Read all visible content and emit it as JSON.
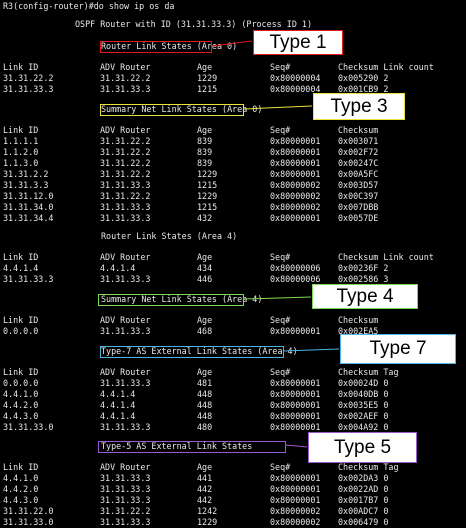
{
  "terminal": {
    "prompt_line": "R3(config-router)#do show ip os da",
    "router_banner": "OSPF Router with ID (31.31.33.3) (Process ID 1)"
  },
  "sections": [
    {
      "title": "Router Link States",
      "area": "(Area 0)",
      "callout": "Type 1",
      "columns": [
        "Link ID",
        "ADV Router",
        "Age",
        "Seq#",
        "Checksum Link count"
      ],
      "rows": [
        [
          "31.31.22.2",
          "31.31.22.2",
          "1229",
          "0x80000004",
          "0x005290 2"
        ],
        [
          "31.31.33.3",
          "31.31.33.3",
          "1215",
          "0x80000004",
          "0x001CB9 2"
        ]
      ]
    },
    {
      "title": "Summary Net Link States",
      "area": "(Area 0)",
      "callout": "Type 3",
      "columns": [
        "Link ID",
        "ADV Router",
        "Age",
        "Seq#",
        "Checksum"
      ],
      "rows": [
        [
          "1.1.1.1",
          "31.31.22.2",
          "839",
          "0x80000001",
          "0x003071"
        ],
        [
          "1.1.2.0",
          "31.31.22.2",
          "839",
          "0x80000001",
          "0x002F72"
        ],
        [
          "1.1.3.0",
          "31.31.22.2",
          "839",
          "0x80000001",
          "0x00247C"
        ],
        [
          "31.31.2.2",
          "31.31.22.2",
          "1229",
          "0x80000001",
          "0x00A5FC"
        ],
        [
          "31.31.3.3",
          "31.31.33.3",
          "1215",
          "0x80000002",
          "0x003D57"
        ],
        [
          "31.31.12.0",
          "31.31.22.2",
          "1229",
          "0x80000002",
          "0x00C397"
        ],
        [
          "31.31.34.0",
          "31.31.33.3",
          "1215",
          "0x80000002",
          "0x007DBB"
        ],
        [
          "31.31.34.4",
          "31.31.33.3",
          "432",
          "0x80000001",
          "0x0057DE"
        ]
      ]
    },
    {
      "title": "Router Link States",
      "area": "(Area 4)",
      "columns": [
        "Link ID",
        "ADV Router",
        "Age",
        "Seq#",
        "Checksum Link count"
      ],
      "rows": [
        [
          "4.4.1.4",
          "4.4.1.4",
          "434",
          "0x80000006",
          "0x00236F 2"
        ],
        [
          "31.31.33.3",
          "31.31.33.3",
          "446",
          "0x80000006",
          "0x002586 3"
        ]
      ]
    },
    {
      "title": "Summary Net Link States",
      "area": "(Area 4)",
      "callout": "Type 4",
      "columns": [
        "Link ID",
        "ADV Router",
        "Age",
        "Seq#",
        "Checksum"
      ],
      "rows": [
        [
          "0.0.0.0",
          "31.31.33.3",
          "468",
          "0x80000001",
          "0x002EA5"
        ]
      ]
    },
    {
      "title": "Type-7 AS External Link States",
      "area": "(Area 4)",
      "callout": "Type 7",
      "columns": [
        "Link ID",
        "ADV Router",
        "Age",
        "Seq#",
        "Checksum Tag"
      ],
      "rows": [
        [
          "0.0.0.0",
          "31.31.33.3",
          "481",
          "0x80000001",
          "0x00024D 0"
        ],
        [
          "4.4.1.0",
          "4.4.1.4",
          "448",
          "0x80000001",
          "0x0040DB 0"
        ],
        [
          "4.4.2.0",
          "4.4.1.4",
          "448",
          "0x80000001",
          "0x0035E5 0"
        ],
        [
          "4.4.3.0",
          "4.4.1.4",
          "448",
          "0x80000001",
          "0x002AEF 0"
        ],
        [
          "31.31.33.0",
          "31.31.33.3",
          "480",
          "0x80000001",
          "0x004A92 0"
        ]
      ]
    },
    {
      "title": "Type-5 AS External Link States",
      "area": "",
      "callout": "Type 5",
      "columns": [
        "Link ID",
        "ADV Router",
        "Age",
        "Seq#",
        "Checksum Tag"
      ],
      "rows": [
        [
          "4.4.1.0",
          "31.31.33.3",
          "441",
          "0x80000001",
          "0x002DA3 0"
        ],
        [
          "4.4.2.0",
          "31.31.33.3",
          "442",
          "0x80000001",
          "0x0022AD 0"
        ],
        [
          "4.4.3.0",
          "31.31.33.3",
          "442",
          "0x80000001",
          "0x0017B7 0"
        ],
        [
          "31.31.22.0",
          "31.31.22.2",
          "1242",
          "0x80000002",
          "0x00ADC7 0"
        ],
        [
          "31.31.33.0",
          "31.31.33.3",
          "1229",
          "0x80000002",
          "0x006479 0"
        ]
      ]
    }
  ],
  "colors": {
    "background": "#000000",
    "text": "#e8e8e8",
    "type1": "#e0191e",
    "type3": "#e8e23a",
    "type4": "#7ed957",
    "type7": "#4fb3e8",
    "type5": "#9b59d0"
  }
}
